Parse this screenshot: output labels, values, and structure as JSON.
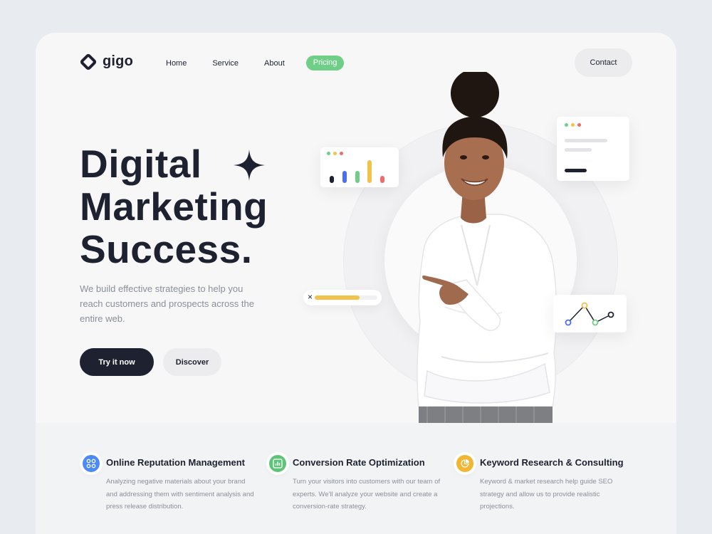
{
  "brand": {
    "name": "gigo",
    "logo_icon": "diamond-logo-icon"
  },
  "nav": {
    "items": [
      {
        "label": "Home"
      },
      {
        "label": "Service"
      },
      {
        "label": "About"
      },
      {
        "label": "Pricing",
        "active": true
      }
    ],
    "contact_label": "Contact"
  },
  "hero": {
    "title_lines": [
      "Digital",
      "Marketing",
      "Success."
    ],
    "description": "We build effective strategies to help you reach customers and prospects across the entire web.",
    "primary_button": "Try it now",
    "secondary_button": "Discover"
  },
  "illustration": {
    "progress_close": "×",
    "progress_value": 0.72,
    "bar_colors": [
      "#1e2230",
      "#4c6ef5",
      "#6fcf86",
      "#f2c34a",
      "#ef6b6b"
    ],
    "dot_colors": [
      "#6fcf86",
      "#f2c34a",
      "#ef6b6b"
    ]
  },
  "services": [
    {
      "icon": "apps-grid-icon",
      "color": "#4c8bf5",
      "title": "Online Reputation Management",
      "description": "Analyzing negative materials about your brand and addressing them with sentiment analysis and press release distribution."
    },
    {
      "icon": "bar-chart-icon",
      "color": "#5fc47a",
      "title": "Conversion Rate Optimization",
      "description": "Turn your visitors into customers with our team of experts. We'll analyze your website and create a conversion-rate strategy."
    },
    {
      "icon": "pie-chart-icon",
      "color": "#f2b632",
      "title": "Keyword Research & Consulting",
      "description": "Keyword & market research help guide SEO strategy and allow us to provide realistic projections."
    }
  ],
  "colors": {
    "primary": "#1e2230",
    "accent": "#6fcf86",
    "background": "#f7f7f8"
  }
}
